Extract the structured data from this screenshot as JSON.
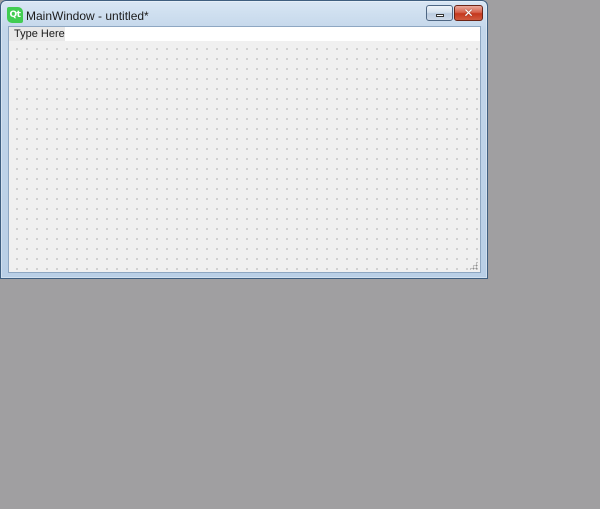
{
  "window": {
    "app_icon_text": "Qt",
    "title": "MainWindow - untitled*",
    "minimize_glyph": "minimize-icon",
    "close_glyph": "✕"
  },
  "menubar": {
    "items": [
      {
        "label": "Type Here"
      }
    ]
  },
  "colors": {
    "desktop": "#a09fa1",
    "qt_green": "#41cd52",
    "close_red": "#c5371d",
    "form_background": "#f0f0f0"
  }
}
